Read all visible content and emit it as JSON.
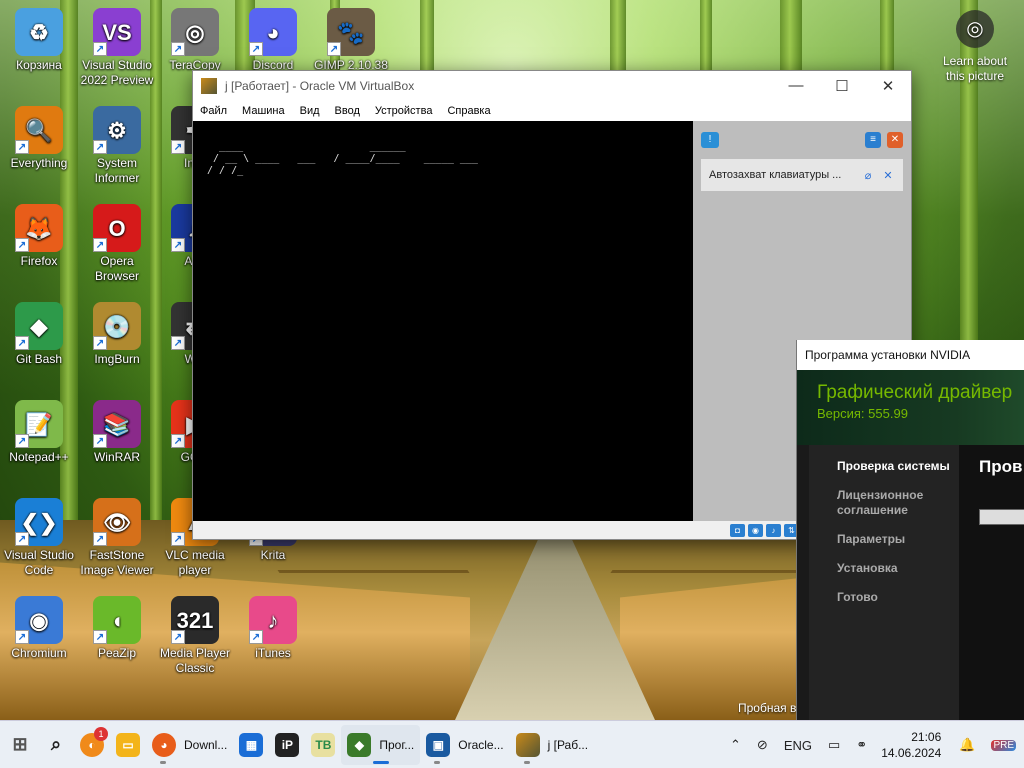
{
  "desktop": {
    "icons": [
      {
        "label": "Корзина",
        "icon": "recycle-bin-icon",
        "color": "#4aa0e0",
        "glyph": "♻"
      },
      {
        "label": "Visual Studio 2022 Preview",
        "icon": "visual-studio-icon",
        "color": "#8a3fd1",
        "glyph": "VS"
      },
      {
        "label": "TeraCopy",
        "icon": "teracopy-icon",
        "color": "#777777",
        "glyph": "◎"
      },
      {
        "label": "Discord",
        "icon": "discord-icon",
        "color": "#5865f2",
        "glyph": "◕"
      },
      {
        "label": "GIMP 2.10.38",
        "icon": "gimp-icon",
        "color": "#6b5b45",
        "glyph": "🐾"
      },
      {
        "label": "Everything",
        "icon": "everything-search-icon",
        "color": "#e07a10",
        "glyph": "🔍"
      },
      {
        "label": "System Informer",
        "icon": "system-informer-icon",
        "color": "#3a6aa0",
        "glyph": "⚙"
      },
      {
        "label": "Inks",
        "icon": "inkscape-icon",
        "color": "#333333",
        "glyph": "✒"
      },
      {
        "label": "Firefox",
        "icon": "firefox-icon",
        "color": "#e85d1a",
        "glyph": "🦊"
      },
      {
        "label": "Opera Browser",
        "icon": "opera-icon",
        "color": "#d61a1a",
        "glyph": "O"
      },
      {
        "label": "Aud",
        "icon": "audacity-icon",
        "color": "#1a3aa0",
        "glyph": "♫"
      },
      {
        "label": "Git Bash",
        "icon": "git-bash-icon",
        "color": "#2d9a4a",
        "glyph": "◆"
      },
      {
        "label": "ImgBurn",
        "icon": "imgburn-icon",
        "color": "#b08a30",
        "glyph": "💿"
      },
      {
        "label": "Win",
        "icon": "winscp-icon",
        "color": "#333333",
        "glyph": "⇄"
      },
      {
        "label": "Notepad++",
        "icon": "notepad-plus-plus-icon",
        "color": "#7fb94a",
        "glyph": "📝"
      },
      {
        "label": "WinRAR",
        "icon": "winrar-icon",
        "color": "#8a2a8a",
        "glyph": "📚"
      },
      {
        "label": "GOM",
        "icon": "gom-player-icon",
        "color": "#e8331a",
        "glyph": "▶"
      },
      {
        "label": "Visual Studio Code",
        "icon": "vscode-icon",
        "color": "#1a7fd6",
        "glyph": "❮❯"
      },
      {
        "label": "FastStone Image Viewer",
        "icon": "faststone-icon",
        "color": "#d6701a",
        "glyph": "👁"
      },
      {
        "label": "VLC media player",
        "icon": "vlc-icon",
        "color": "#f08a10",
        "glyph": "▲"
      },
      {
        "label": "Krita",
        "icon": "krita-icon",
        "color": "#3a3a6a",
        "glyph": "🖌"
      },
      {
        "label": "Chromium",
        "icon": "chromium-icon",
        "color": "#3a7ad6",
        "glyph": "◉"
      },
      {
        "label": "PeaZip",
        "icon": "peazip-icon",
        "color": "#6ab92a",
        "glyph": "◖"
      },
      {
        "label": "Media Player Classic",
        "icon": "mpc-icon",
        "color": "#2a2a2a",
        "glyph": "321"
      },
      {
        "label": "iTunes",
        "icon": "itunes-icon",
        "color": "#e84a8a",
        "glyph": "♪"
      }
    ],
    "learn_about": "Learn about this picture",
    "trial_text": "Пробная в"
  },
  "vbox": {
    "title": "j [Работает] - Oracle VM VirtualBox",
    "menu": [
      "Файл",
      "Машина",
      "Вид",
      "Ввод",
      "Устройства",
      "Справка"
    ],
    "console_ascii": "   ____                     ______\n  / __ \\ ____   ___   / ____/____    _____ ___\n / / /_",
    "notice": "Автозахват клавиатуры ..."
  },
  "nvidia": {
    "window_title": "Программа установки NVIDIA",
    "heading": "Графический драйвер",
    "version": "Версия: 555.99",
    "steps": [
      "Проверка системы",
      "Лицензионное соглашение",
      "Параметры",
      "Установка",
      "Готово"
    ],
    "main_heading": "Пров",
    "progress": 0.15,
    "brand_color": "#76b900"
  },
  "taskbar": {
    "items": [
      {
        "label": "",
        "icon": "start-windows-icon"
      },
      {
        "label": "",
        "icon": "search-icon"
      },
      {
        "label": "",
        "icon": "firefox-notification-icon",
        "badge": "1"
      },
      {
        "label": "",
        "icon": "file-explorer-icon"
      },
      {
        "label": "Downl...",
        "icon": "firefox-taskbar-icon"
      },
      {
        "label": "",
        "icon": "microsoft-store-icon"
      },
      {
        "label": "",
        "icon": "iobit-icon"
      },
      {
        "label": "",
        "icon": "tb-app-icon"
      },
      {
        "label": "Прог...",
        "icon": "nvidia-installer-icon"
      },
      {
        "label": "Oracle...",
        "icon": "virtualbox-icon"
      },
      {
        "label": "j [Раб...",
        "icon": "vm-window-icon"
      }
    ],
    "lang": "ENG",
    "time": "21:06",
    "date": "14.06.2024"
  }
}
